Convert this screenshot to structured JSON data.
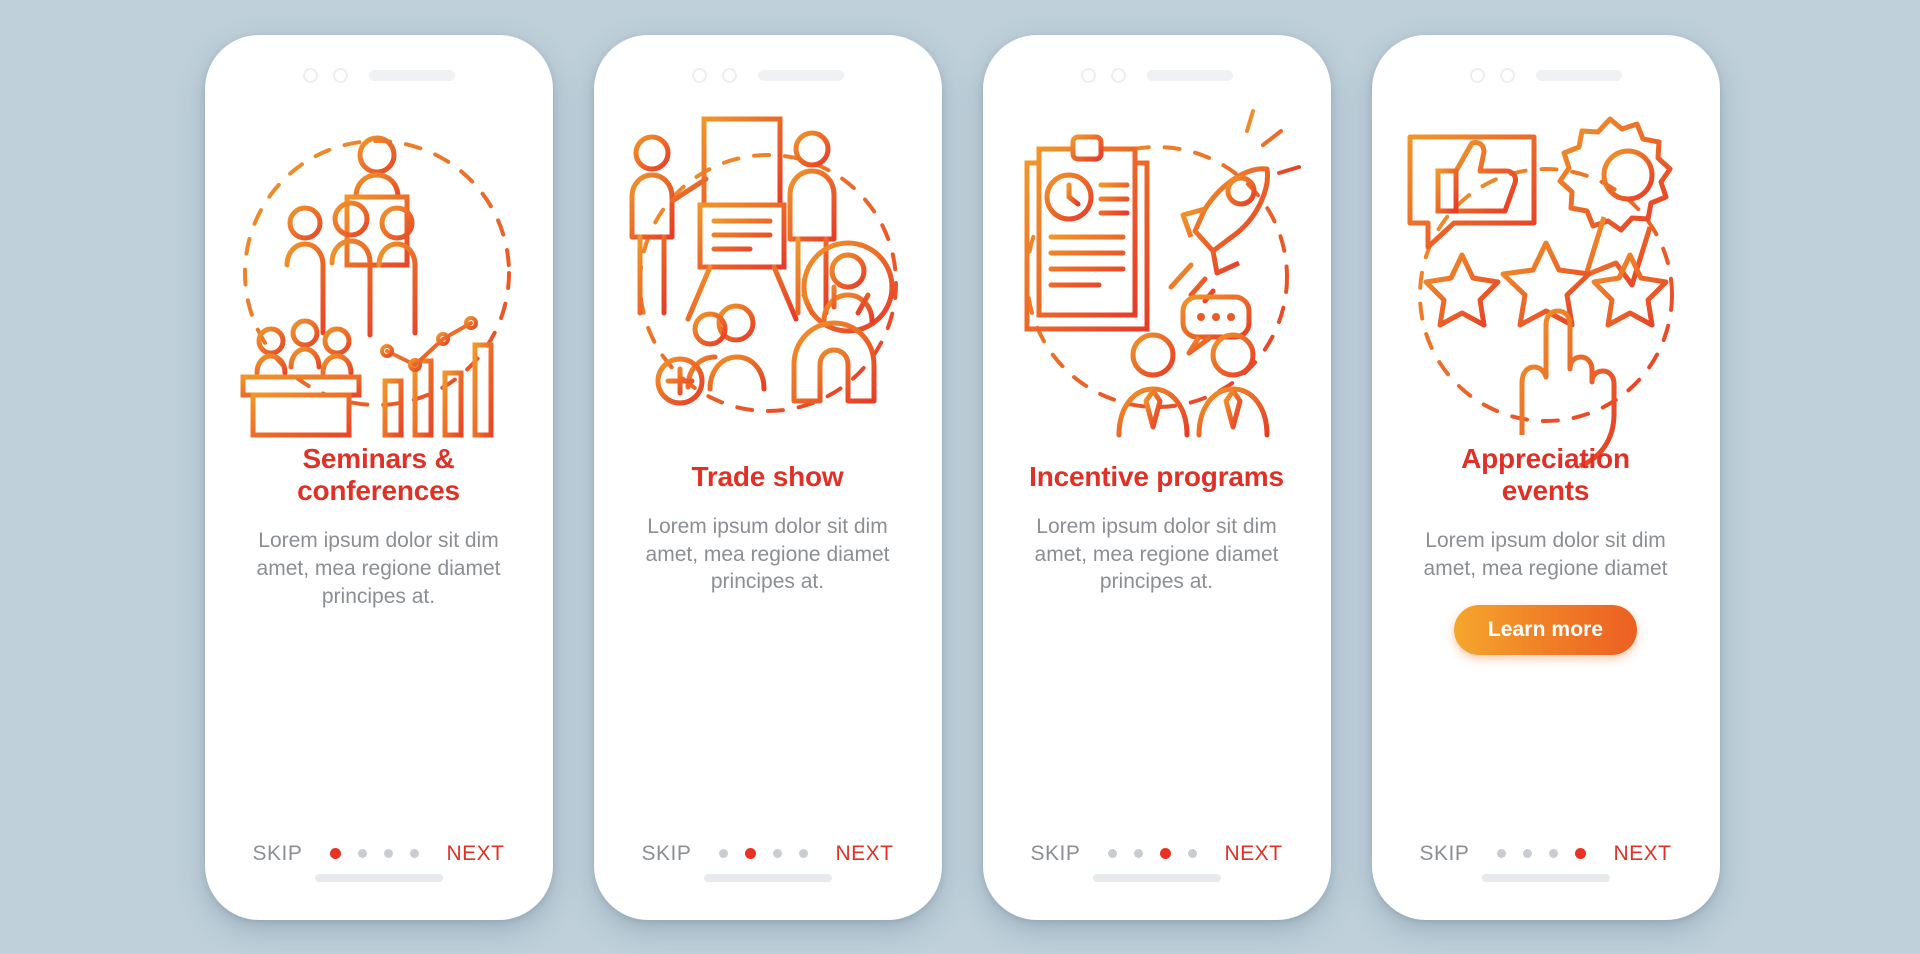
{
  "theme": {
    "background": "#bfd0da",
    "accent_red": "#e03127",
    "accent_orange": "#ec5f22",
    "muted_text": "#8b8f93",
    "dot_inactive": "#c9cdd1",
    "dot_active": "#ea3223",
    "cta_gradient_from": "#f5a62c",
    "cta_gradient_to": "#ec5f22"
  },
  "shared": {
    "skip_label": "SKIP",
    "next_label": "NEXT",
    "dot_count": 4,
    "description": "Lorem ipsum dolor sit dim amet, mea regione diamet principes at."
  },
  "screens": [
    {
      "id": "seminars-conferences",
      "title": "Seminars & conferences",
      "title_lines": [
        "Seminars &",
        "conferences"
      ],
      "description": "Lorem ipsum dolor sit dim amet, mea regione diamet principes at.",
      "skip_label": "SKIP",
      "next_label": "NEXT",
      "active_dot": 1,
      "cta": null,
      "illustration": "audience-presentation-chart-icon"
    },
    {
      "id": "trade-show",
      "title": "Trade show",
      "title_lines": [
        "Trade show"
      ],
      "description": "Lorem ipsum dolor sit dim amet, mea regione diamet principes at.",
      "skip_label": "SKIP",
      "next_label": "NEXT",
      "active_dot": 2,
      "cta": null,
      "illustration": "presenter-audience-magnet-icon"
    },
    {
      "id": "incentive-programs",
      "title": "Incentive programs",
      "title_lines": [
        "Incentive programs"
      ],
      "description": "Lorem ipsum dolor sit dim amet, mea regione diamet principes at.",
      "skip_label": "SKIP",
      "next_label": "NEXT",
      "active_dot": 3,
      "cta": null,
      "illustration": "clipboard-rocket-team-icon"
    },
    {
      "id": "appreciation-events",
      "title": "Appreciation events",
      "title_lines": [
        "Appreciation",
        "events"
      ],
      "description": "Lorem ipsum dolor sit dim amet, mea regione diamet",
      "skip_label": "SKIP",
      "next_label": "NEXT",
      "active_dot": 4,
      "cta": "Learn more",
      "illustration": "thumbsup-award-stars-icon"
    }
  ]
}
